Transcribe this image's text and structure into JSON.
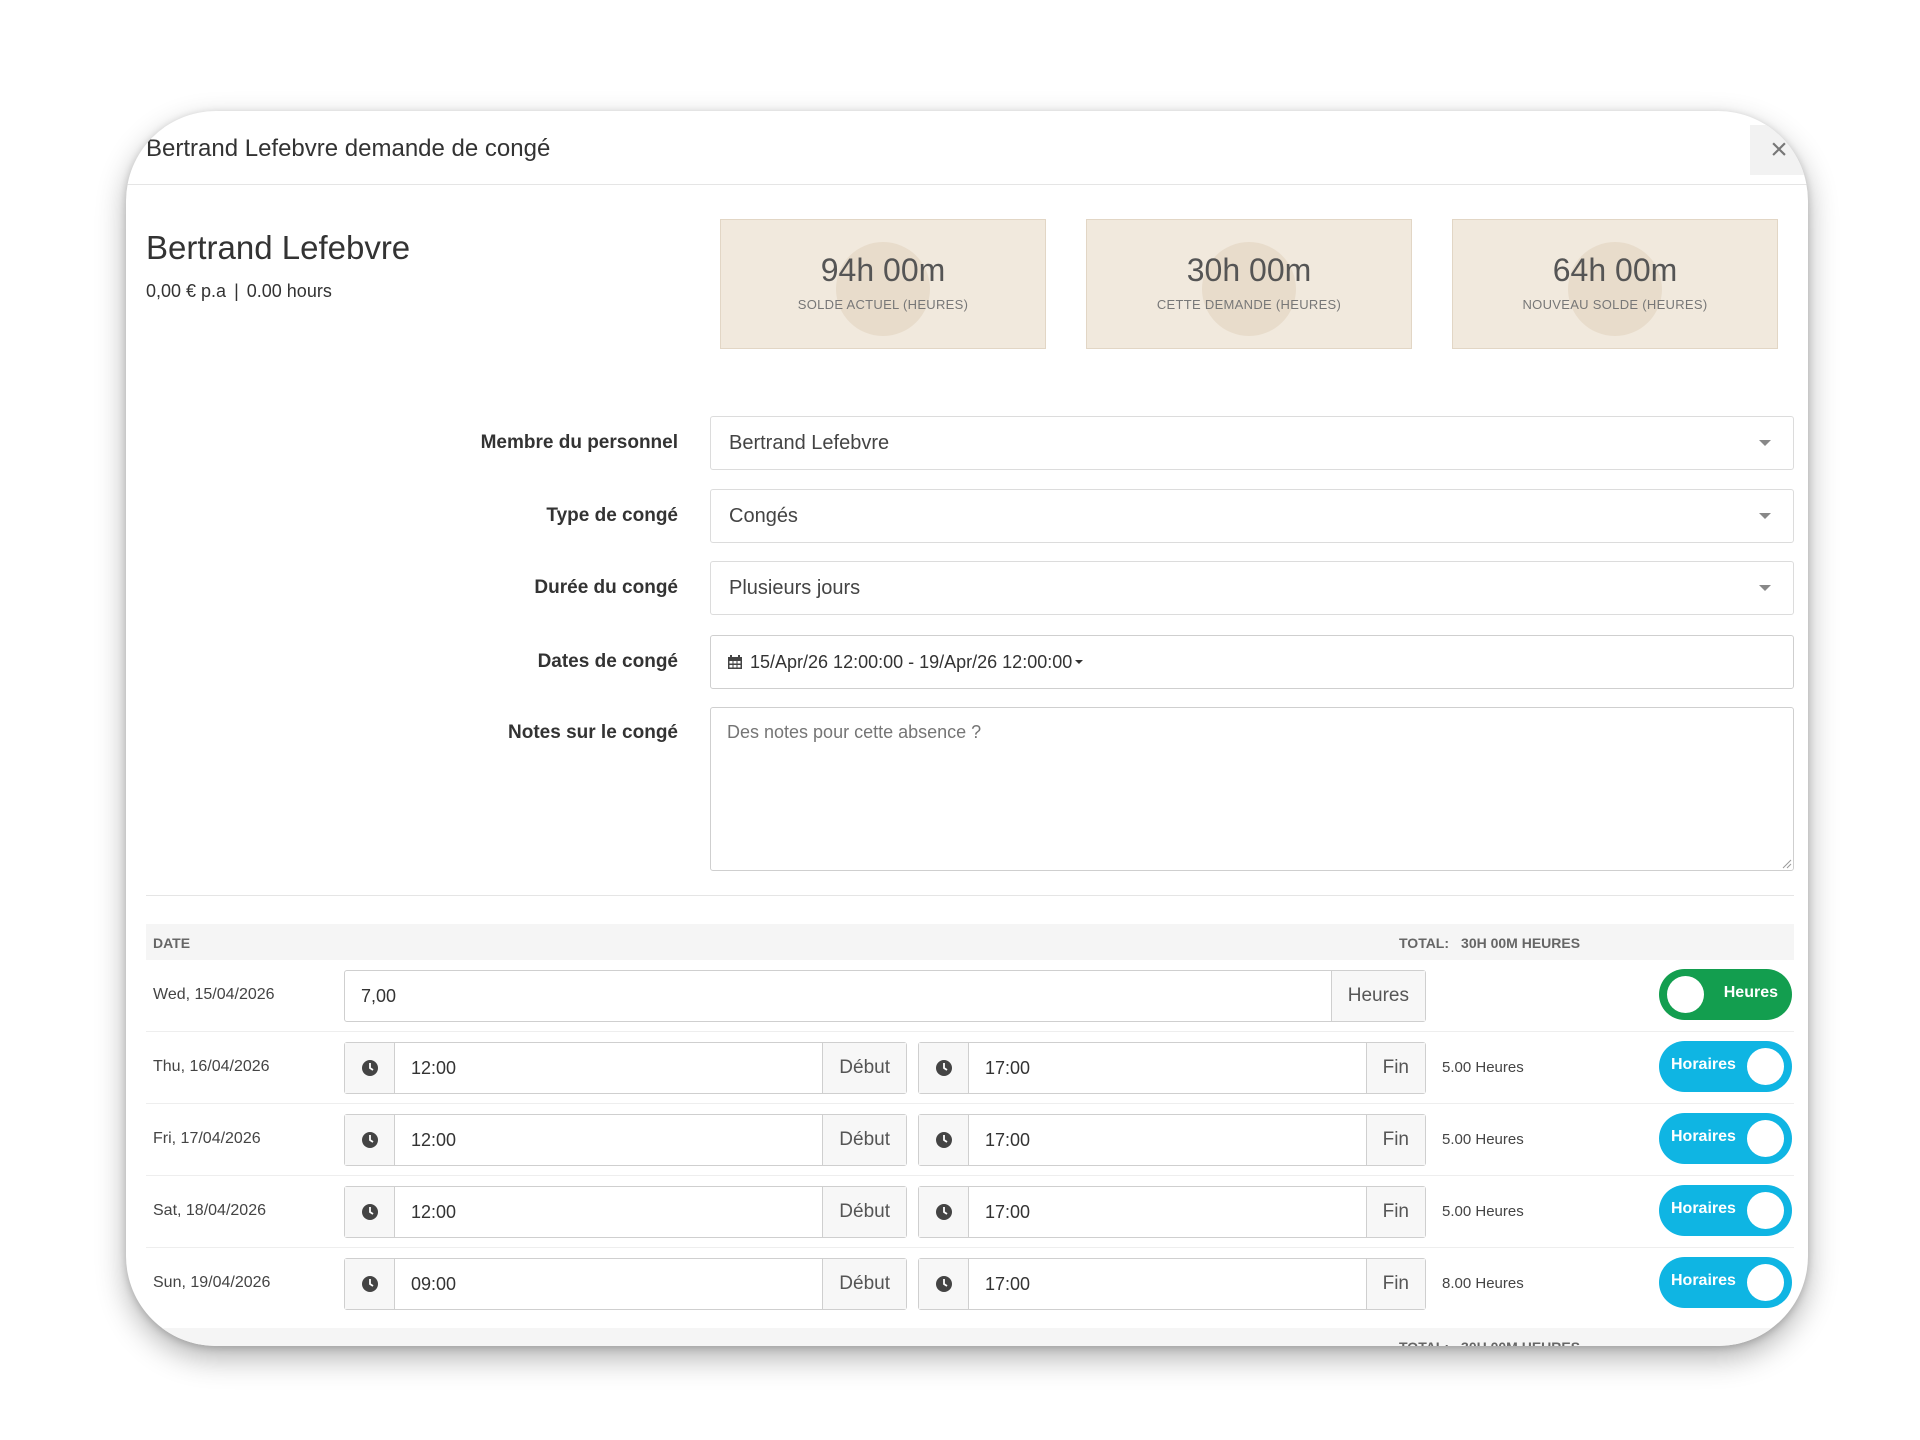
{
  "modal": {
    "title": "Bertrand Lefebvre demande de congé",
    "close_label": "×"
  },
  "employee": {
    "name": "Bertrand Lefebvre",
    "salary": "0,00 € p.a",
    "separator": "|",
    "hours": "0.00 hours"
  },
  "stats": [
    {
      "value": "94h 00m",
      "label": "SOLDE ACTUEL (HEURES)"
    },
    {
      "value": "30h 00m",
      "label": "CETTE DEMANDE (HEURES)"
    },
    {
      "value": "64h 00m",
      "label": "NOUVEAU SOLDE (HEURES)"
    }
  ],
  "form": {
    "staff_label": "Membre du personnel",
    "staff_value": "Bertrand Lefebvre",
    "type_label": "Type de congé",
    "type_value": "Congés",
    "duration_label": "Durée du congé",
    "duration_value": "Plusieurs jours",
    "dates_label": "Dates de congé",
    "dates_value": "15/Apr/26 12:00:00 - 19/Apr/26 12:00:00",
    "notes_label": "Notes sur le congé",
    "notes_placeholder": "Des notes pour cette absence ?"
  },
  "table": {
    "date_header": "DATE",
    "total_label": "TOTAL:",
    "total_value": "30H 00M HEURES",
    "rows": [
      {
        "date": "Wed, 15/04/2026",
        "hours_input": "7,00",
        "hours_unit": "Heures",
        "toggle_label": "Heures",
        "mode": "hours"
      },
      {
        "date": "Thu, 16/04/2026",
        "start": "12:00",
        "start_label": "Début",
        "end": "17:00",
        "end_label": "Fin",
        "hours": "5.00 Heures",
        "toggle_label": "Horaires",
        "mode": "times"
      },
      {
        "date": "Fri, 17/04/2026",
        "start": "12:00",
        "start_label": "Début",
        "end": "17:00",
        "end_label": "Fin",
        "hours": "5.00 Heures",
        "toggle_label": "Horaires",
        "mode": "times"
      },
      {
        "date": "Sat, 18/04/2026",
        "start": "12:00",
        "start_label": "Début",
        "end": "17:00",
        "end_label": "Fin",
        "hours": "5.00 Heures",
        "toggle_label": "Horaires",
        "mode": "times"
      },
      {
        "date": "Sun, 19/04/2026",
        "start": "09:00",
        "start_label": "Début",
        "end": "17:00",
        "end_label": "Fin",
        "hours": "8.00 Heures",
        "toggle_label": "Horaires",
        "mode": "times"
      }
    ]
  },
  "colors": {
    "toggle_hours": "#139e4f",
    "toggle_times": "#0fb5e3",
    "stat_background": "#f1e9dd"
  },
  "icons": [
    "close-icon",
    "calendar-icon",
    "caret-down-icon",
    "clock-icon"
  ]
}
